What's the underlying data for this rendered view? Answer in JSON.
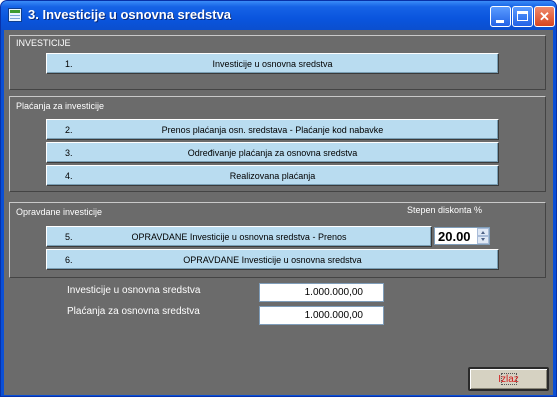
{
  "window": {
    "title": "3. Investicije u osnovna sredstva",
    "icon": "form-window-icon",
    "controls": {
      "minimize": "minimize-icon",
      "maximize": "maximize-icon",
      "close": "✕"
    }
  },
  "groups": [
    {
      "label": "INVESTICIJE",
      "buttons": [
        {
          "num": "1.",
          "label": "Investicije u osnovna sredstva"
        }
      ]
    },
    {
      "label": "Plaćanja za investicije",
      "buttons": [
        {
          "num": "2.",
          "label": "Prenos plaćanja osn. sredstava - Plaćanje kod nabavke"
        },
        {
          "num": "3.",
          "label": "Određivanje plaćanja za osnovna sredstva"
        },
        {
          "num": "4.",
          "label": "Realizovana  plaćanja"
        }
      ]
    },
    {
      "label": "Opravdane  investicije",
      "buttons": [
        {
          "num": "5.",
          "label": "OPRAVDANE  Investicije u osnovna sredstva  - Prenos"
        },
        {
          "num": "6.",
          "label": "OPRAVDANE  Investicije u osnovna sredstva"
        }
      ]
    }
  ],
  "discount": {
    "label": "Stepen diskonta %",
    "value": "20.00"
  },
  "summary": [
    {
      "label": "Investicije u osnovna sredstva",
      "value": "1.000.000,00"
    },
    {
      "label": "Plaćanja za osnovna sredstva",
      "value": "1.000.000,00"
    }
  ],
  "exit_button": {
    "label": "Izlaz"
  },
  "colors": {
    "panel_background": "#6b6b6b",
    "menu_button_background": "#b9dcf0",
    "titlebar": "#0a55de",
    "exit_text": "#d11a1a"
  }
}
